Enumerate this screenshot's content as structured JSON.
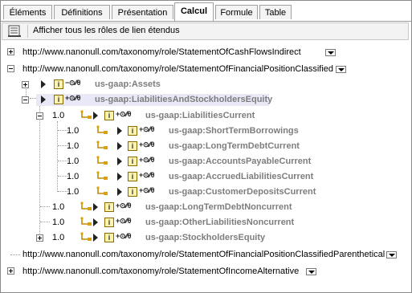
{
  "tabs": [
    "Éléments",
    "Définitions",
    "Présentation",
    "Calcul",
    "Formule",
    "Table"
  ],
  "active_tab": "Calcul",
  "toolbar": {
    "label": "Afficher tous les rôles de lien étendus"
  },
  "roles": {
    "cashflows": "http://www.nanonull.com/taxonomy/role/StatementOfCashFlowsIndirect",
    "finpos": "http://www.nanonull.com/taxonomy/role/StatementOfFinancialPositionClassified",
    "finpos_paren": "http://www.nanonull.com/taxonomy/role/StatementOfFinancialPositionClassifiedParenthetical",
    "income": "http://www.nanonull.com/taxonomy/role/StatementOfIncomeAlternative"
  },
  "icon_letter": "i",
  "symbols": {
    "minus": "−⊙⁄⁄θ",
    "plus": "+⊙⁄⁄θ"
  },
  "nodes": {
    "assets": "us-gaap:Assets",
    "liab_se": "us-gaap:LiabilitiesAndStockholdersEquity",
    "liab_cur": "us-gaap:LiabilitiesCurrent",
    "stb": "us-gaap:ShortTermBorrowings",
    "ltdc": "us-gaap:LongTermDebtCurrent",
    "apc": "us-gaap:AccountsPayableCurrent",
    "alc": "us-gaap:AccruedLiabilitiesCurrent",
    "cdc": "us-gaap:CustomerDepositsCurrent",
    "ltdn": "us-gaap:LongTermDebtNoncurrent",
    "oln": "us-gaap:OtherLiabilitiesNoncurrent",
    "se": "us-gaap:StockholdersEquity"
  },
  "weights": {
    "one": "1.0"
  }
}
